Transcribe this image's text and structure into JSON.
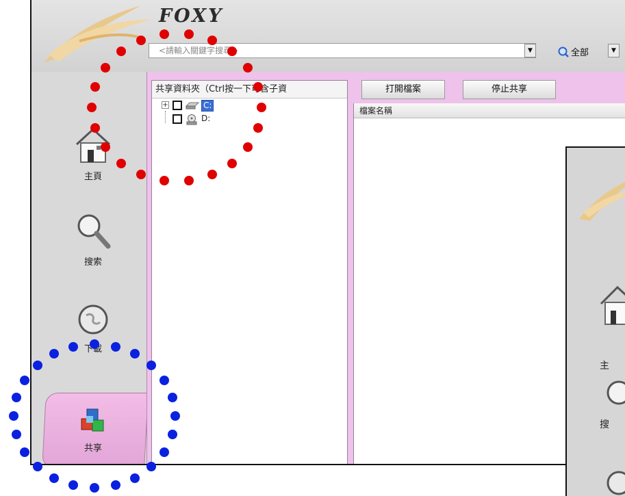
{
  "app": {
    "brand": "FOXY",
    "search": {
      "placeholder": "<請輸入關鍵字搜尋>"
    },
    "scope": {
      "label": "全部"
    }
  },
  "nav": {
    "items": [
      {
        "label": "主頁",
        "icon": "home-icon"
      },
      {
        "label": "搜索",
        "icon": "magnifier-icon"
      },
      {
        "label": "下載",
        "icon": "globe-icon"
      },
      {
        "label": "共享",
        "icon": "share-cubes-icon",
        "active": true
      }
    ]
  },
  "share": {
    "folder_header": "共享資料夾（Ctrl按一下可含子資",
    "drives": [
      {
        "label": "C:",
        "selected": true,
        "icon": "hard-drive-icon"
      },
      {
        "label": "D:",
        "selected": false,
        "icon": "cd-drive-icon"
      }
    ],
    "buttons": {
      "open": "打開檔案",
      "stop": "停止共享"
    },
    "file_column": "檔案名稱"
  },
  "inset": {
    "partial_labels": [
      "主",
      "搜"
    ]
  },
  "colors": {
    "accent_pink": "#eec2ea",
    "annotation_red": "#e00000",
    "annotation_blue": "#0b21e0",
    "selection_blue": "#3a6fd6"
  }
}
